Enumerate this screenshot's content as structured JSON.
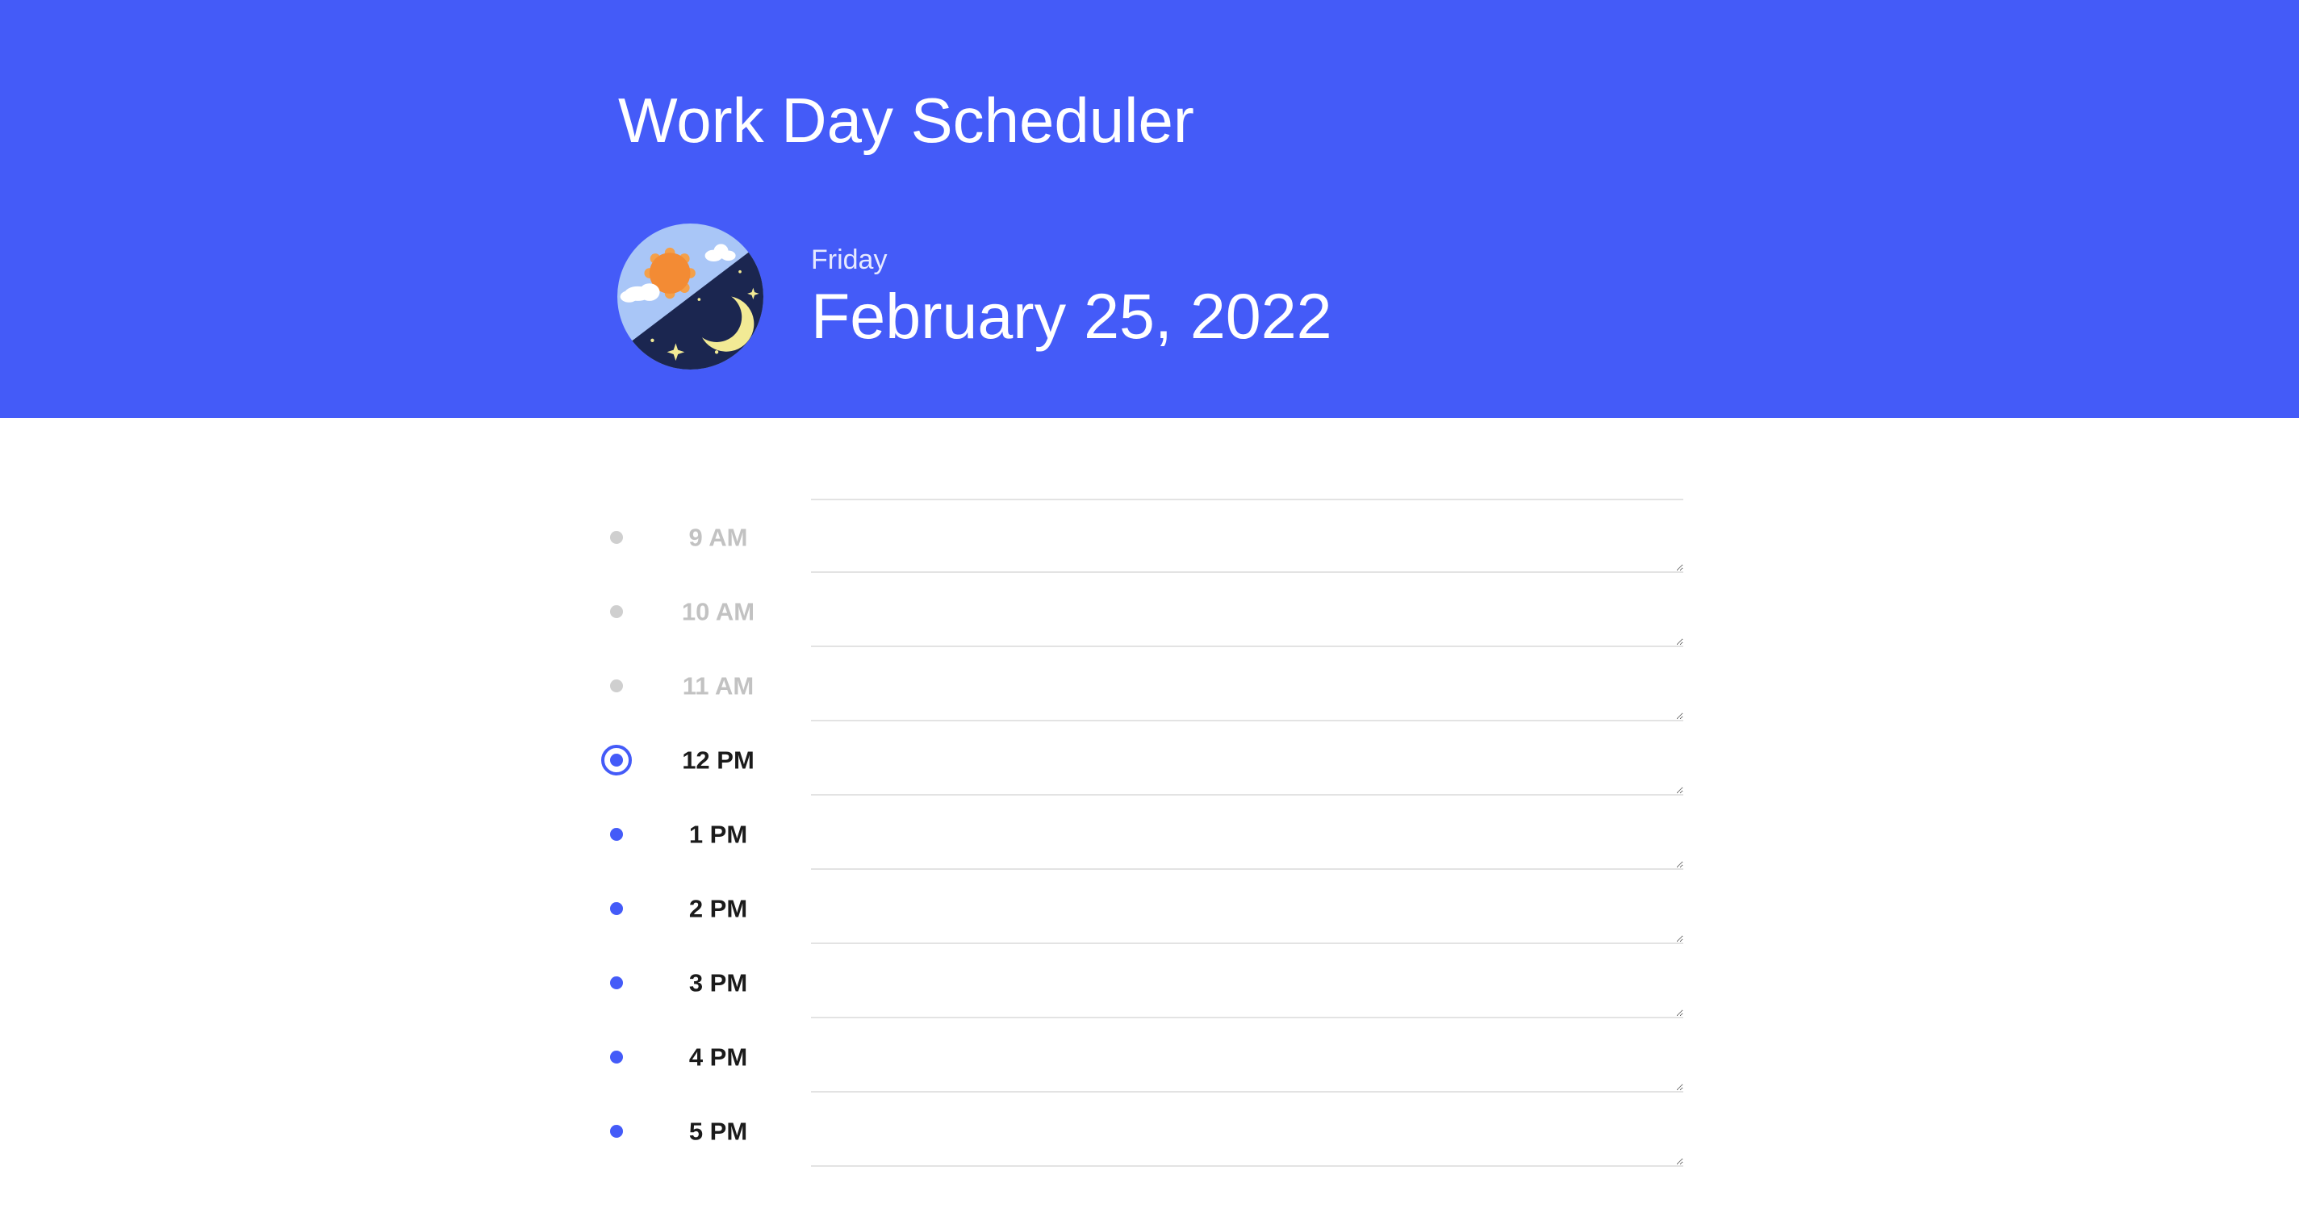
{
  "header": {
    "title": "Work Day Scheduler",
    "icon": "day-night-icon",
    "weekday": "Friday",
    "date": "February 25, 2022",
    "accent_color": "#445bf8"
  },
  "schedule": {
    "hours": [
      {
        "label": "9 AM",
        "status": "past",
        "note": ""
      },
      {
        "label": "10 AM",
        "status": "past",
        "note": ""
      },
      {
        "label": "11 AM",
        "status": "past",
        "note": ""
      },
      {
        "label": "12 PM",
        "status": "present",
        "note": ""
      },
      {
        "label": "1 PM",
        "status": "future",
        "note": ""
      },
      {
        "label": "2 PM",
        "status": "future",
        "note": ""
      },
      {
        "label": "3 PM",
        "status": "future",
        "note": ""
      },
      {
        "label": "4 PM",
        "status": "future",
        "note": ""
      },
      {
        "label": "5 PM",
        "status": "future",
        "note": ""
      }
    ]
  }
}
